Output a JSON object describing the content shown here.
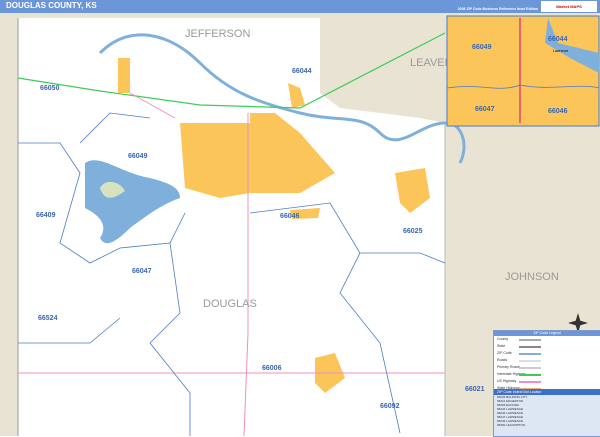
{
  "header": {
    "title": "DOUGLAS COUNTY, KS",
    "subtitle": "2026 ZIP Code Business Reference Inset Edition",
    "logo": "Market MAPS"
  },
  "map": {
    "counties": [
      "JEFFERSON",
      "LEAVENWORTH",
      "JOHNSON",
      "DOUGLAS"
    ],
    "zips": [
      "66050",
      "66044",
      "66049",
      "66409",
      "66046",
      "66025",
      "66047",
      "66524",
      "66006",
      "66092",
      "66021"
    ],
    "inset_zips": [
      "66049",
      "66044",
      "66047",
      "66046"
    ],
    "inset_city": "Lawrence",
    "colors": {
      "land": "#e8e3d3",
      "county": "#ffffff",
      "water": "#7fb0dc",
      "urban": "#fbc55a",
      "zip_line": "#4a7cc4",
      "highway": "#3dcc5a",
      "route": "#f08fc0"
    }
  },
  "legend": {
    "title": "ZIP Code Legend",
    "items": [
      "County",
      "State",
      "ZIP Code",
      "Roads",
      "Primary Roads",
      "Interstate Highway",
      "US Highway",
      "State Highway"
    ],
    "index_title": "ZIP Code Index/Grid Locator",
    "index_rows": [
      "66006 BALDWIN CITY",
      "66021 EDGERTON",
      "66025 EUDORA",
      "66044 LAWRENCE",
      "66046 LAWRENCE",
      "66047 LAWRENCE",
      "66049 LAWRENCE",
      "66050 LECOMPTON"
    ]
  }
}
